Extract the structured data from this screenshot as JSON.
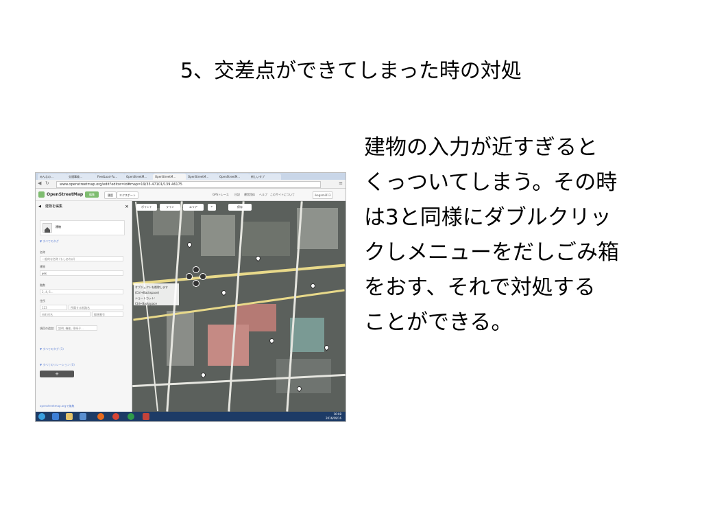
{
  "slide": {
    "title": "5、交差点ができてしまった時の対処",
    "body_lines": [
      "建物の入力が近すぎると",
      "くっついてしまう。その時",
      "は3と同様にダブルクリッ",
      "クしメニューをだしごみ箱",
      "をおす、それで対処する",
      "ことができる。"
    ]
  },
  "screenshot": {
    "url": "www.openstreetmap.org/edit?editor=id#map=19/35.47101/139.46175",
    "osm": {
      "site_name": "OpenStreetMap",
      "edit_button": "編集",
      "history_button": "履歴",
      "export_button": "エクスポート",
      "nav_links": [
        "GPSトレース",
        "日記",
        "運営団体",
        "ヘルプ",
        "このサイトについて"
      ],
      "user": "ikegami013"
    },
    "sidebar": {
      "header": "建物を編集",
      "close": "×",
      "preset": "建物",
      "section_all_fields": "▼ すべてのタグ",
      "field_name_label": "名称",
      "field_name_placeholder": "一般的な名称 (もしあれば)",
      "field_building_label": "建物",
      "field_building_value": "yes",
      "field_levels_label": "階数",
      "field_levels_value": "2, 4, 6...",
      "field_address_label": "住所",
      "field_address_values": [
        "123",
        "所属する街路名",
        "市町村名",
        "郵便番号"
      ],
      "add_field_label": "項目の追加:",
      "add_field_placeholder": "説明, 機能, 車椅子...",
      "all_tags_link": "▼ すべてのタグ (1)",
      "all_relations_link": "▼ すべてのリレーション (0)",
      "add_button": "+",
      "footer_link": "openstreetmap.orgで編集"
    },
    "map_toolbar": {
      "point": "ポイント",
      "line": "ライン",
      "area": "エリア",
      "undo": "↶",
      "save": "保存"
    },
    "tooltip_lines": [
      "オブジェクトを削除します (Ctrl+Backspace)",
      "ショートカット: Ctrl+Backspace"
    ],
    "taskbar": {
      "time": "16:08",
      "date": "2016/09/16"
    },
    "tabs": [
      "みんなの…",
      "交通事故…",
      "FeedLoad-Fu…",
      "OpenStreetM…",
      "OpenStreetM…",
      "OpenStreetM…",
      "OpenStreetM…",
      "新しいタブ"
    ]
  }
}
